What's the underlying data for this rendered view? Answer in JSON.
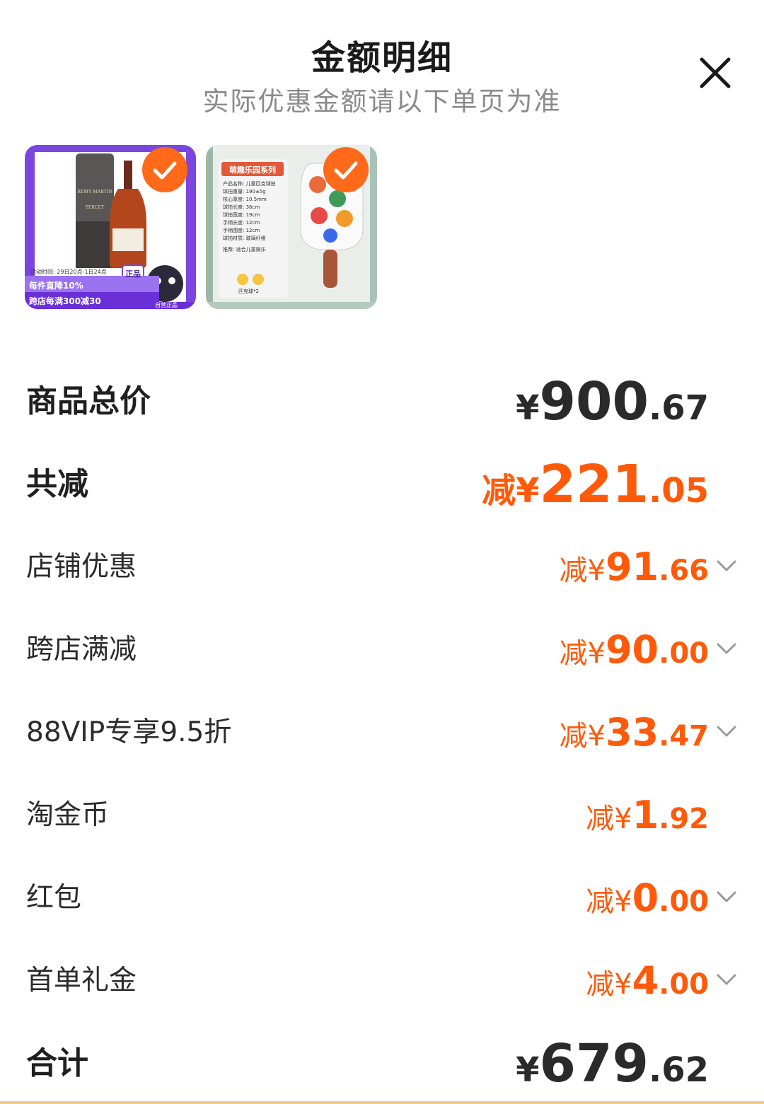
{
  "header": {
    "title": "金额明细",
    "subtitle": "实际优惠金额请以下单页为准"
  },
  "icons": {
    "close": "close-icon",
    "check": "check-icon",
    "expand": "chevron-down-icon"
  },
  "colors": {
    "accent": "#ff5a0a",
    "check_badge": "#ff6a1a",
    "promo_purple": "#7b46e0"
  },
  "products": [
    {
      "name": "REMY MARTIN TERCET",
      "brand_text": "REMY MARTIN",
      "model_text": "TERCET",
      "promo_time": "活动时间: 29日20点-1日24点",
      "promo_line1": "每件直降10%",
      "promo_line2": "跨店每满300减30",
      "tag_genuine": "正品",
      "tag_self": "自营正品",
      "selected": true
    },
    {
      "series": "萌趣乐园系列",
      "specs": [
        "产品名称: 儿童匹克球拍",
        "球拍重量: 190±5g",
        "核心厚度: 10.5mm",
        "球拍长度: 36cm",
        "球拍宽度: 19cm",
        "手柄长度: 12cm",
        "手柄围度: 12cm",
        "球拍材质: 玻璃纤维"
      ],
      "recommend": "推荐: 适合儿童娱乐",
      "ball_text": "匹克球*2",
      "selected": true
    }
  ],
  "summary": {
    "total": {
      "label": "商品总价",
      "prefix": "¥",
      "int": "900",
      "dec": ".67"
    },
    "discount_total": {
      "label": "共减",
      "prefix": "减¥",
      "int": "221",
      "dec": ".05"
    },
    "items": [
      {
        "label": "店铺优惠",
        "prefix": "减¥",
        "int": "91",
        "dec": ".66",
        "expandable": true
      },
      {
        "label": "跨店满减",
        "prefix": "减¥",
        "int": "90",
        "dec": ".00",
        "expandable": true
      },
      {
        "label": "88VIP专享9.5折",
        "prefix": "减¥",
        "int": "33",
        "dec": ".47",
        "expandable": true
      },
      {
        "label": "淘金币",
        "prefix": "减¥",
        "int": "1",
        "dec": ".92",
        "expandable": false
      },
      {
        "label": "红包",
        "prefix": "减¥",
        "int": "0",
        "dec": ".00",
        "expandable": true
      },
      {
        "label": "首单礼金",
        "prefix": "减¥",
        "int": "4",
        "dec": ".00",
        "expandable": true
      }
    ],
    "grand_total": {
      "label": "合计",
      "prefix": "¥",
      "int": "679",
      "dec": ".62"
    }
  }
}
